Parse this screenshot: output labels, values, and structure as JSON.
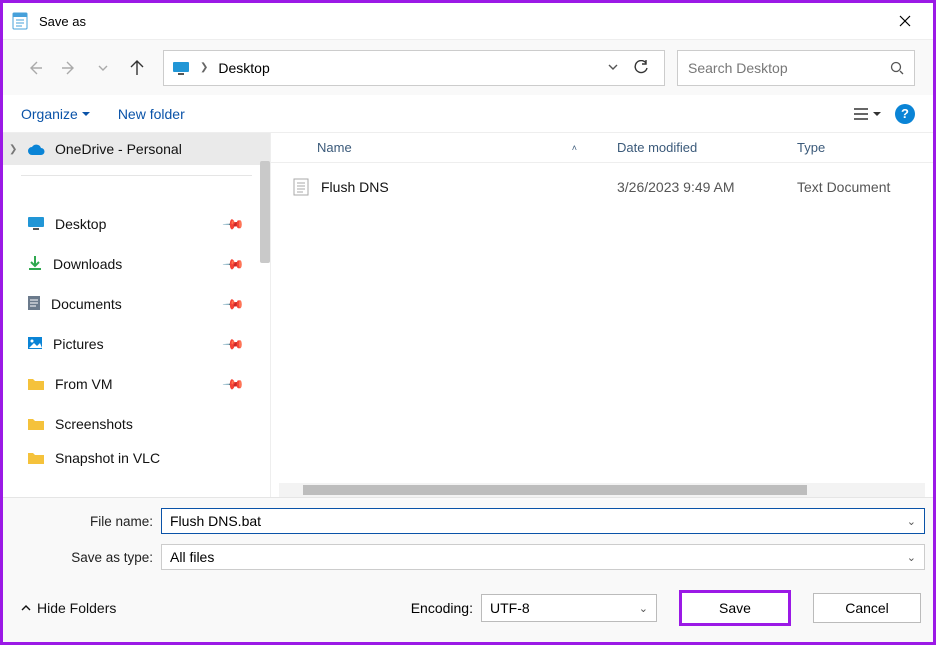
{
  "window": {
    "title": "Save as"
  },
  "nav": {
    "breadcrumb": [
      "Desktop"
    ],
    "search_placeholder": "Search Desktop"
  },
  "toolbar": {
    "organize": "Organize",
    "new_folder": "New folder"
  },
  "sidebar": {
    "items": [
      {
        "id": "onedrive",
        "label": "OneDrive - Personal",
        "icon": "cloud",
        "color": "#0a84d6",
        "selected": true,
        "expandable": true
      },
      {
        "id": "desktop",
        "label": "Desktop",
        "icon": "monitor",
        "color": "#0a84d6",
        "pinned": true
      },
      {
        "id": "downloads",
        "label": "Downloads",
        "icon": "download",
        "color": "#2fa84f",
        "pinned": true
      },
      {
        "id": "documents",
        "label": "Documents",
        "icon": "document",
        "color": "#6b7a8c",
        "pinned": true
      },
      {
        "id": "pictures",
        "label": "Pictures",
        "icon": "pictures",
        "color": "#0a84d6",
        "pinned": true
      },
      {
        "id": "fromvm",
        "label": "From VM",
        "icon": "folder",
        "color": "#f5c23b",
        "pinned": true
      },
      {
        "id": "screenshots",
        "label": "Screenshots",
        "icon": "folder",
        "color": "#f5c23b",
        "pinned": false
      },
      {
        "id": "snapshotvlc",
        "label": "Snapshot in VLC",
        "icon": "folder",
        "color": "#f5c23b",
        "pinned": false,
        "clipped": true
      }
    ]
  },
  "filelist": {
    "columns": {
      "name": "Name",
      "date": "Date modified",
      "type": "Type"
    },
    "sort_column": "name",
    "rows": [
      {
        "name": "Flush DNS",
        "date": "3/26/2023 9:49 AM",
        "type": "Text Document"
      }
    ]
  },
  "fields": {
    "filename_label": "File name:",
    "filename_value": "Flush DNS.bat",
    "saveastype_label": "Save as type:",
    "saveastype_value": "All files"
  },
  "footer": {
    "hide_folders": "Hide Folders",
    "encoding_label": "Encoding:",
    "encoding_value": "UTF-8",
    "save": "Save",
    "cancel": "Cancel"
  }
}
